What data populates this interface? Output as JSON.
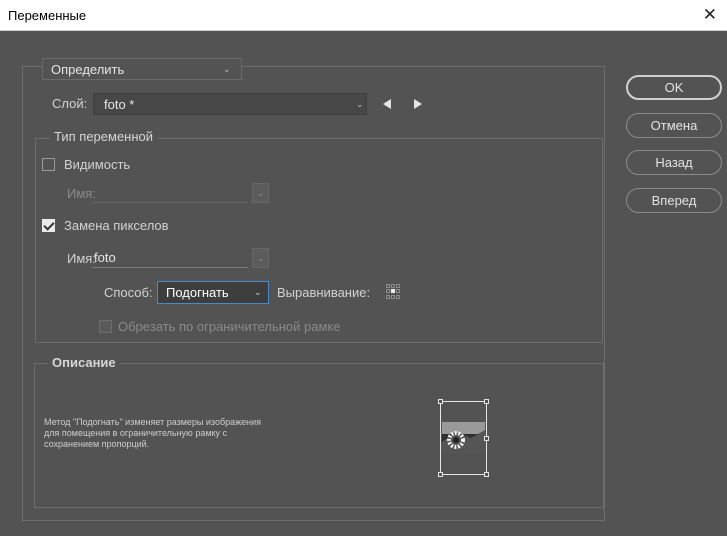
{
  "window": {
    "title": "Переменные",
    "close_glyph": "✕"
  },
  "mode": {
    "value": "Определить"
  },
  "layer": {
    "label": "Слой:",
    "value": "foto *"
  },
  "variable_type": {
    "legend": "Тип переменной",
    "visibility": {
      "label": "Видимость",
      "checked": false,
      "name_label": "Имя:",
      "name_value": ""
    },
    "pixel_replacement": {
      "label": "Замена пикселов",
      "checked": true,
      "name_label": "Имя:",
      "name_value": "foto"
    },
    "method_label": "Способ:",
    "method_value": "Подогнать",
    "alignment_label": "Выравнивание:",
    "clip_label": "Обрезать по ограничительной рамке"
  },
  "description": {
    "legend": "Описание",
    "line1": "Метод \"Подогнать\" изменяет размеры изображения",
    "line2": "для помещения в ограничительную рамку с",
    "line3": "сохранением пропорций."
  },
  "buttons": {
    "ok": "OK",
    "cancel": "Отмена",
    "back": "Назад",
    "forward": "Вперед"
  },
  "icons": [
    "close-icon",
    "chevron-down-icon",
    "previous-layer-icon",
    "next-layer-icon",
    "alignment-grid-icon",
    "fit-preview-icon"
  ],
  "colors": {
    "dialog_bg": "#535353",
    "accent": "#4a88c7",
    "titlebar_bg": "#ffffff"
  }
}
